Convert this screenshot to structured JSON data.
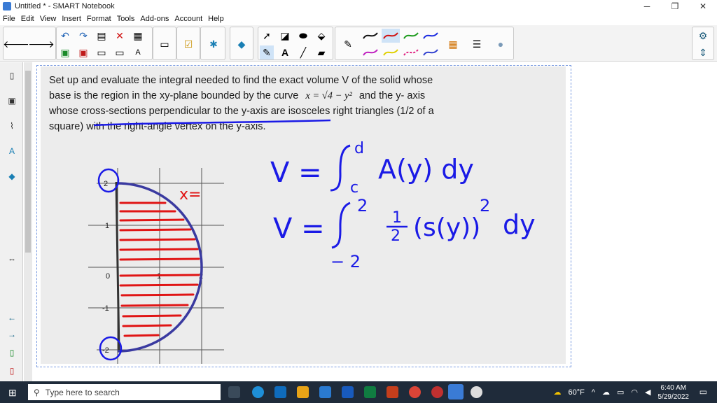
{
  "window": {
    "title": "Untitled * - SMART Notebook",
    "minimize": "─",
    "restore": "❐",
    "close": "✕"
  },
  "menu": [
    "File",
    "Edit",
    "View",
    "Insert",
    "Format",
    "Tools",
    "Add-ons",
    "Account",
    "Help"
  ],
  "problem": {
    "line1": "Set up and evaluate the integral needed to find the exact volume V of the solid whose",
    "line2": "base is the region in the xy-plane bounded by the curve",
    "formula": "x = √4 − y²",
    "line2b": "and the y- axis",
    "line3": "whose cross-sections perpendicular to the y-axis are isosceles right triangles (1/2 of a",
    "line4": "square) with the right-angle vertex on the y-axis."
  },
  "graph": {
    "y_ticks": [
      "2",
      "1",
      "0",
      "-1",
      "-2"
    ],
    "x_ticks": [
      "1",
      "2"
    ]
  },
  "handwriting": {
    "eq1_lhs": "V =",
    "eq1_upper": "d",
    "eq1_lower": "c",
    "eq1_body": "A(y) dy",
    "eq2_lhs": "V =",
    "eq2_upper": "2",
    "eq2_lower": "− 2",
    "eq2_frac_num": "1",
    "eq2_frac_den": "2",
    "eq2_body": "(s(y))",
    "eq2_exp": "2",
    "eq2_tail": "dy",
    "x_label": "x="
  },
  "taskbar": {
    "search_placeholder": "Type here to search",
    "weather": "60°F",
    "time": "6:40 AM",
    "date": "5/29/2022"
  },
  "colors": {
    "ink_blue": "#1a1ae6",
    "ink_red": "#e01515",
    "curve": "#3a3aa0"
  }
}
